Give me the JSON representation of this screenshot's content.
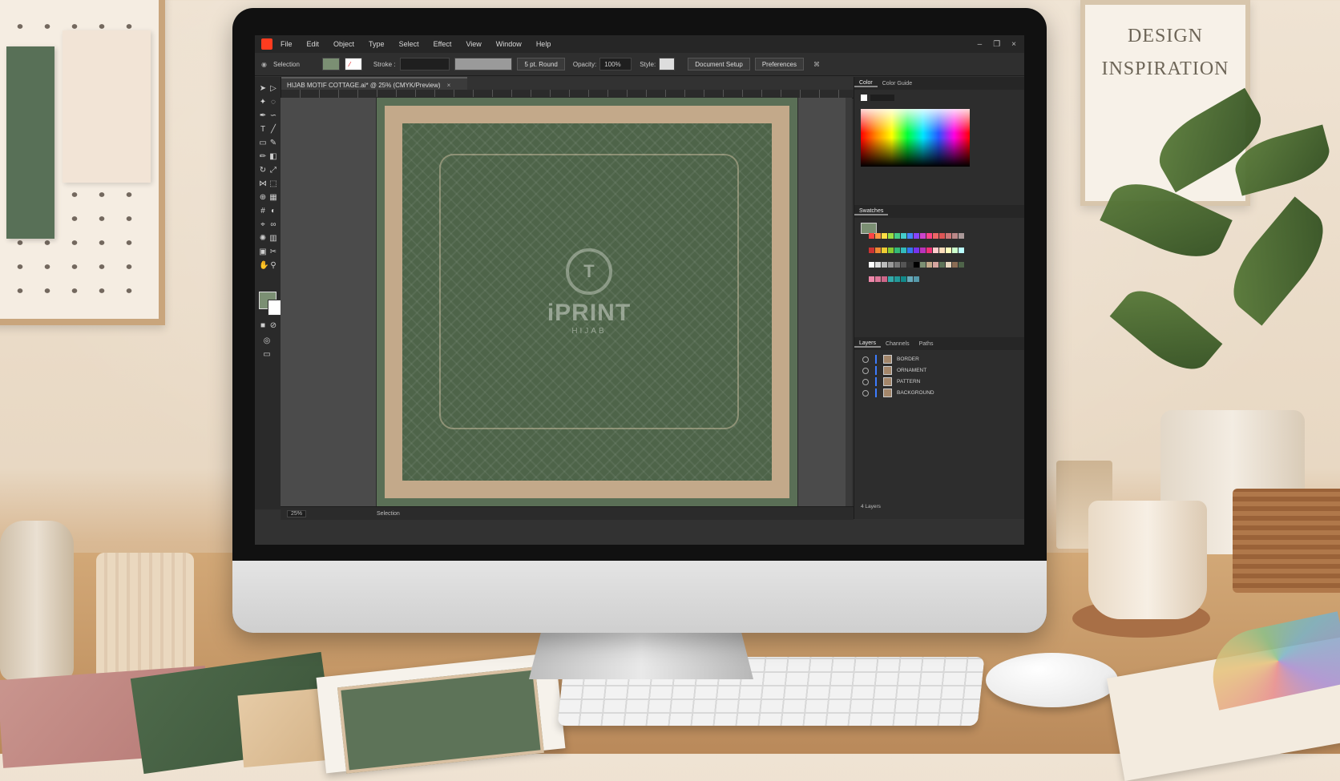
{
  "scene": {
    "poster_text": [
      "DESIGN",
      "INSPIRATION"
    ]
  },
  "app": {
    "menu": [
      "File",
      "Edit",
      "Object",
      "Type",
      "Select",
      "Effect",
      "View",
      "Window",
      "Help"
    ],
    "window_controls": [
      "–",
      "❐",
      "×"
    ],
    "options_bar": {
      "selection_label": "Selection",
      "stroke_label": "Stroke :",
      "brush_label": "5 pt. Round",
      "opacity_label": "Opacity:",
      "opacity_value": "100%",
      "style_label": "Style:",
      "document_setup": "Document Setup",
      "preferences": "Preferences"
    },
    "document_tab": "HIJAB MOTIF COTTAGE.ai* @ 25% (CMYK/Preview)",
    "status": {
      "zoom": "25%",
      "selection": "Selection"
    },
    "artwork": {
      "watermark_brand": "iPRINT",
      "watermark_sub": "HIJAB",
      "logo_glyph": "T"
    },
    "panels": {
      "color_tabs": [
        "Color",
        "Color Guide"
      ],
      "swatches_title": "Swatches",
      "layers_tabs": [
        "Layers",
        "Channels",
        "Paths"
      ],
      "layers": [
        "BORDER",
        "ORNAMENT",
        "PATTERN",
        "BACKGROUND"
      ],
      "layers_count": "4 Layers"
    },
    "colors": {
      "fill": "#7b8f73",
      "accent_layer": "#3d7cff",
      "app_logo": "#ff3c1f"
    }
  }
}
